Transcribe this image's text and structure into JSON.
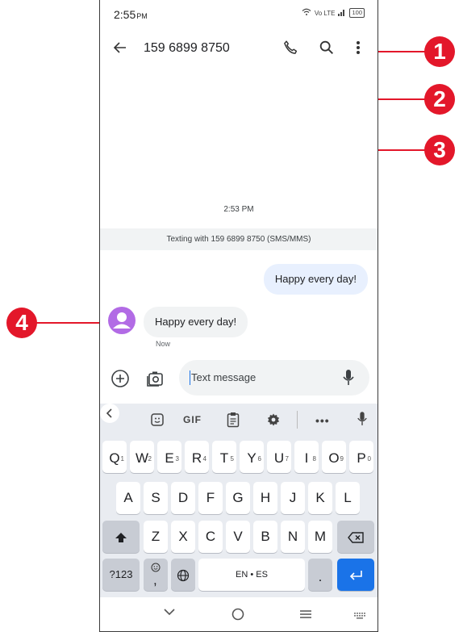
{
  "status_bar": {
    "time": "2:55",
    "ampm": "PM",
    "network": "Vo LTE",
    "battery": "100"
  },
  "app_bar": {
    "contact": "159 6899 8750"
  },
  "conversation": {
    "timestamp": "2:53 PM",
    "texting_banner": "Texting with 159 6899 8750 (SMS/MMS)",
    "outgoing_message": "Happy every day!",
    "incoming_message": "Happy every day!",
    "incoming_time": "Now"
  },
  "composer": {
    "placeholder": "Text message"
  },
  "keyboard": {
    "toolbar": {
      "gif": "GIF"
    },
    "row1": [
      {
        "k": "Q",
        "h": "1"
      },
      {
        "k": "W",
        "h": "2"
      },
      {
        "k": "E",
        "h": "3"
      },
      {
        "k": "R",
        "h": "4"
      },
      {
        "k": "T",
        "h": "5"
      },
      {
        "k": "Y",
        "h": "6"
      },
      {
        "k": "U",
        "h": "7"
      },
      {
        "k": "I",
        "h": "8"
      },
      {
        "k": "O",
        "h": "9"
      },
      {
        "k": "P",
        "h": "0"
      }
    ],
    "row2": [
      "A",
      "S",
      "D",
      "F",
      "G",
      "H",
      "J",
      "K",
      "L"
    ],
    "row3": [
      "Z",
      "X",
      "C",
      "V",
      "B",
      "N",
      "M"
    ],
    "symbols_key": "?123",
    "comma_key": ",",
    "space_key": "EN • ES",
    "period_key": "."
  },
  "callouts": [
    "1",
    "2",
    "3",
    "4"
  ],
  "colors": {
    "callout": "#e3172a",
    "accent": "#1a73e8",
    "avatar": "#b26be5"
  }
}
